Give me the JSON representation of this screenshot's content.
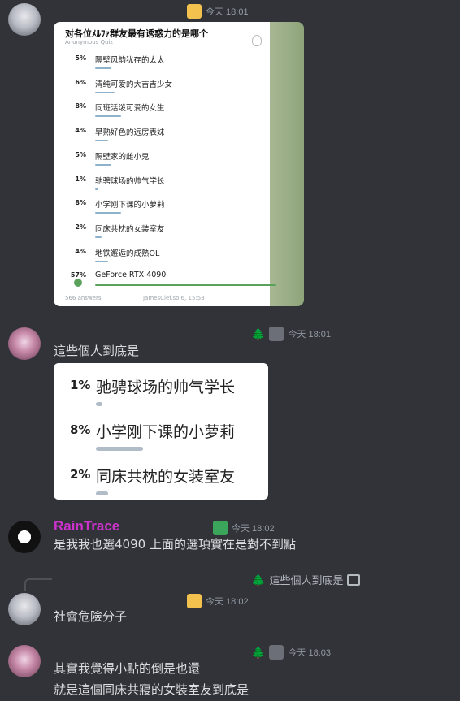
{
  "messages": [
    {
      "timestamp": "今天 18:01"
    },
    {
      "timestamp": "今天 18:01",
      "text": "這些個人到底是"
    },
    {
      "author": "RainTrace",
      "timestamp": "今天 18:02",
      "text": "是我我也選4090 上面的選項實在是對不到點"
    },
    {
      "reply_preview": "這些個人到底是",
      "timestamp": "今天 18:02",
      "text": "社會危險分子"
    },
    {
      "timestamp": "今天 18:03",
      "line1": "其實我覺得小點的倒是也還",
      "line2": "就是這個同床共寢的女裝室友到底是"
    }
  ],
  "poll": {
    "title": "对各位ﾒﾙﾌｧ群友最有诱惑力的是哪个",
    "subtitle": "Anonymous Quiz",
    "options": [
      {
        "pct": "5%",
        "label": "隔壁风韵犹存的太太",
        "value": 5
      },
      {
        "pct": "6%",
        "label": "清纯可爱的大吉吉少女",
        "value": 6
      },
      {
        "pct": "8%",
        "label": "同班活泼可爱的女生",
        "value": 8
      },
      {
        "pct": "4%",
        "label": "早熟好色的远房表妹",
        "value": 4
      },
      {
        "pct": "5%",
        "label": "隔壁家的雌小鬼",
        "value": 5
      },
      {
        "pct": "1%",
        "label": "驰骋球场的帅气学长",
        "value": 1
      },
      {
        "pct": "8%",
        "label": "小学刚下课的小萝莉",
        "value": 8
      },
      {
        "pct": "2%",
        "label": "同床共枕的女装室友",
        "value": 2
      },
      {
        "pct": "4%",
        "label": "地铁邂逅的成熟OL",
        "value": 4
      },
      {
        "pct": "57%",
        "label": "GeForce RTX 4090",
        "value": 57
      }
    ],
    "answers": "566 answers",
    "footer_right": "JamesClef.so 6, 15:53"
  },
  "zoom": {
    "options": [
      {
        "pct": "1%",
        "label": "驰骋球场的帅气学长",
        "value": 1
      },
      {
        "pct": "8%",
        "label": "小学刚下课的小萝莉",
        "value": 8
      },
      {
        "pct": "2%",
        "label": "同床共枕的女装室友",
        "value": 2
      }
    ]
  },
  "colors": {
    "background": "#313338",
    "author_raintrace": "#cc33cc",
    "bar": "#8fb2cc",
    "tree": "#3ba55c"
  },
  "icons": {
    "tree": "🌲"
  }
}
